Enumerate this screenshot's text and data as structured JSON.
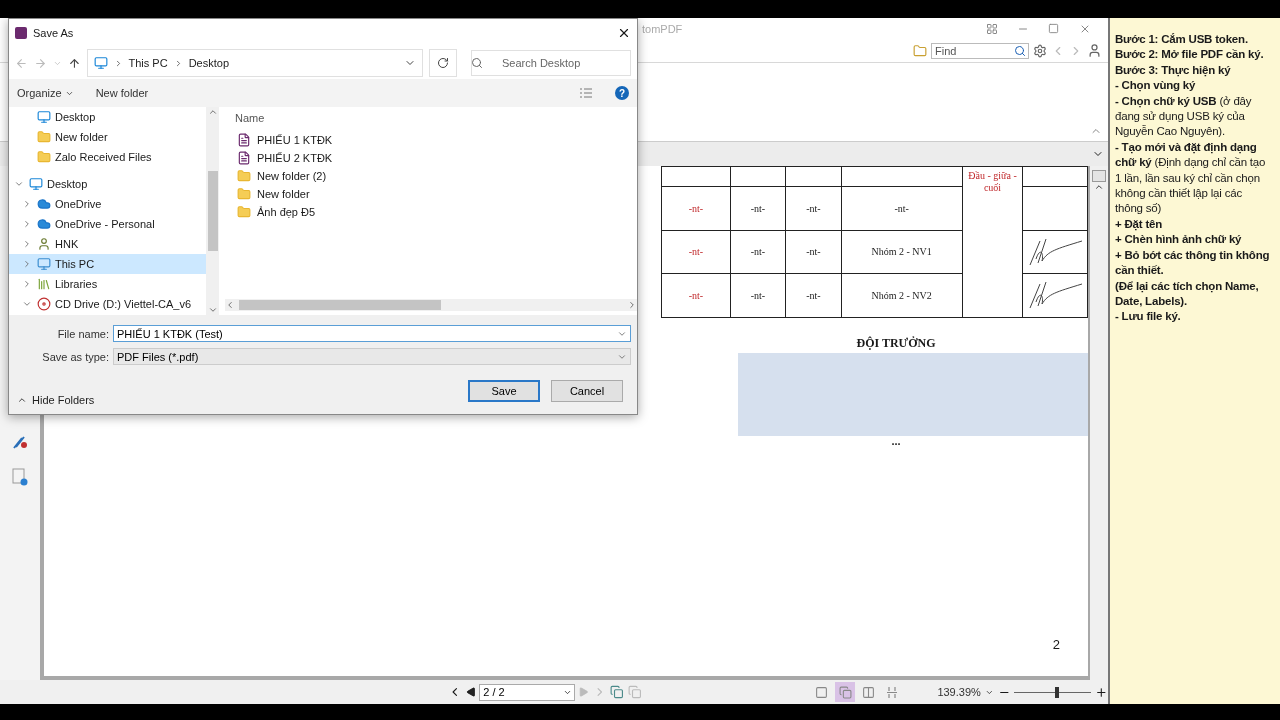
{
  "app": {
    "title": "tomPDF",
    "find": {
      "placeholder": "Find"
    }
  },
  "dialog": {
    "title": "Save As",
    "address": [
      "This PC",
      "Desktop"
    ],
    "search": {
      "placeholder": "Search Desktop"
    },
    "commands": [
      {
        "label": "Organize",
        "menu": true
      },
      {
        "label": "New folder",
        "menu": false
      }
    ],
    "help": "?",
    "nav": {
      "quick_access": [
        {
          "label": "Desktop",
          "kind": "desktop",
          "selected": false
        },
        {
          "label": "New folder",
          "kind": "folder",
          "selected": false
        },
        {
          "label": "Zalo Received Files",
          "kind": "folder",
          "selected": false
        }
      ],
      "tree": [
        {
          "label": "Desktop",
          "kind": "desktop",
          "expanded": true,
          "selected": false,
          "children": [
            {
              "label": "OneDrive",
              "kind": "cloud",
              "expanded": false,
              "selected": false
            },
            {
              "label": "OneDrive - Personal",
              "kind": "cloud",
              "expanded": false,
              "selected": false
            },
            {
              "label": "HNK",
              "kind": "user",
              "expanded": false,
              "selected": false
            },
            {
              "label": "This PC",
              "kind": "pc",
              "expanded": false,
              "selected": true
            },
            {
              "label": "Libraries",
              "kind": "library",
              "expanded": false,
              "selected": false
            },
            {
              "label": "CD Drive (D:) Viettel-CA_v6",
              "kind": "drive",
              "expanded": true,
              "selected": false
            }
          ]
        }
      ]
    },
    "files": {
      "column": "Name",
      "items": [
        {
          "name": "PHIẾU 1 KTĐK",
          "kind": "pdf"
        },
        {
          "name": "PHIẾU 2 KTĐK",
          "kind": "pdf"
        },
        {
          "name": "New folder (2)",
          "kind": "folder"
        },
        {
          "name": "New folder",
          "kind": "folder"
        },
        {
          "name": "Ảnh đẹp Đ5",
          "kind": "folder"
        }
      ]
    },
    "file_name": {
      "label": "File name:",
      "value": "PHIẾU 1 KTĐK (Test)"
    },
    "save_type": {
      "label": "Save as type:",
      "value": "PDF Files (*.pdf)"
    },
    "hide_folders": "Hide Folders",
    "buttons": [
      {
        "label": "Save",
        "default": true
      },
      {
        "label": "Cancel",
        "default": false
      }
    ]
  },
  "document": {
    "merged_note": "Đầu - giữa - cuối",
    "rows": [
      {
        "cells": [
          "-nt-",
          "-nt-",
          "-nt-",
          "-nt-"
        ],
        "signed": false
      },
      {
        "cells": [
          "-nt-",
          "-nt-",
          "-nt-",
          "Nhóm 2 - NV1"
        ],
        "signed": true
      },
      {
        "cells": [
          "-nt-",
          "-nt-",
          "-nt-",
          "Nhóm 2 - NV2"
        ],
        "signed": true
      }
    ],
    "heading": "ĐỘI TRƯỞNG",
    "ellipsis": "...",
    "page_number": "2"
  },
  "status_bar": {
    "page": "2 / 2",
    "view_modes": [
      {
        "kind": "single",
        "selected": false
      },
      {
        "kind": "continuous",
        "selected": true
      },
      {
        "kind": "facing",
        "selected": false
      },
      {
        "kind": "split",
        "selected": false
      }
    ],
    "zoom": "139.39%",
    "zoom_slider": {
      "level": 0.54
    }
  },
  "notes": [
    {
      "text": "Bước 1: Cắm USB token.",
      "bold": true
    },
    {
      "text": "Bước 2: Mở file PDF cần ký.",
      "bold": true
    },
    {
      "text": "Bước 3: Thực hiện ký",
      "bold": true
    },
    {
      "text": "- Chọn vùng ký",
      "bold": true
    },
    {
      "text": "**- Chọn chữ ký USB** (ở đây đang sử dụng USB ký của Nguyễn Cao Nguyên).",
      "bold": false
    },
    {
      "text": "**- Tạo mới và đặt định dạng chữ ký**  (Định dạng chỉ cần tạo 1 lần, lần sau ký chỉ cần chọn không cần thiết lập lại các thông số)",
      "bold": false
    },
    {
      "text": "+ Đặt tên",
      "bold": true
    },
    {
      "text": "+ Chèn hình ảnh chữ ký",
      "bold": true
    },
    {
      "text": "+ Bỏ bớt các thông tin không cần thiết.",
      "bold": true
    },
    {
      "text": "(Để lại các tích chọn Name, Date, Labels).",
      "bold": true
    },
    {
      "text": "- Lưu file ký.",
      "bold": true
    }
  ]
}
